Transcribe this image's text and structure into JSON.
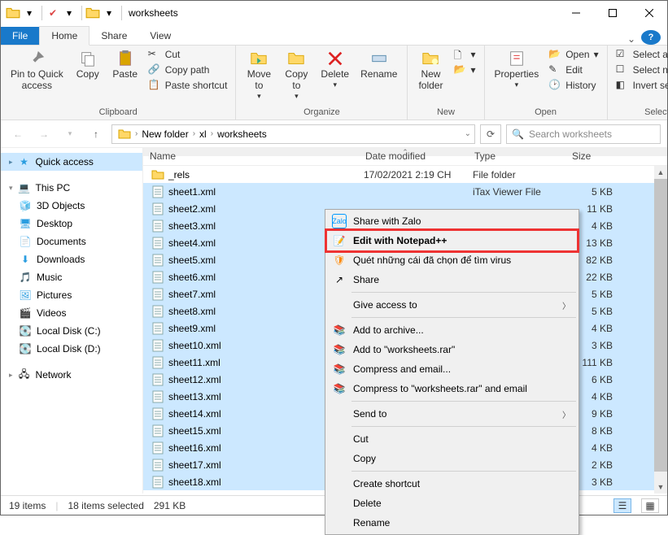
{
  "titlebar": {
    "title": "worksheets"
  },
  "tabs": {
    "file": "File",
    "home": "Home",
    "share": "Share",
    "view": "View"
  },
  "ribbon": {
    "clipboard": {
      "pin": "Pin to Quick\naccess",
      "copy": "Copy",
      "paste": "Paste",
      "cut": "Cut",
      "copypath": "Copy path",
      "pasteshort": "Paste shortcut",
      "label": "Clipboard"
    },
    "organize": {
      "moveto": "Move\nto",
      "copyto": "Copy\nto",
      "delete": "Delete",
      "rename": "Rename",
      "label": "Organize"
    },
    "new": {
      "newfolder": "New\nfolder",
      "label": "New"
    },
    "open": {
      "properties": "Properties",
      "open": "Open",
      "edit": "Edit",
      "history": "History",
      "label": "Open"
    },
    "select": {
      "selectall": "Select all",
      "selectnone": "Select none",
      "invert": "Invert selection",
      "label": "Select"
    }
  },
  "breadcrumb": {
    "b1": "New folder",
    "b2": "xl",
    "b3": "worksheets"
  },
  "search": {
    "placeholder": "Search worksheets"
  },
  "sidebar": {
    "quick": "Quick access",
    "thispc": "This PC",
    "obj3d": "3D Objects",
    "desktop": "Desktop",
    "documents": "Documents",
    "downloads": "Downloads",
    "music": "Music",
    "pictures": "Pictures",
    "videos": "Videos",
    "localc": "Local Disk (C:)",
    "locald": "Local Disk (D:)",
    "network": "Network"
  },
  "columns": {
    "name": "Name",
    "mod": "Date modified",
    "type": "Type",
    "size": "Size"
  },
  "files": [
    {
      "name": "_rels",
      "mod": "17/02/2021 2:19 CH",
      "type": "File folder",
      "size": "",
      "folder": true,
      "sel": false
    },
    {
      "name": "sheet1.xml",
      "mod": "",
      "type": "iTax Viewer File",
      "size": "5 KB",
      "sel": true
    },
    {
      "name": "sheet2.xml",
      "mod": "",
      "type": "",
      "size": "11 KB",
      "sel": true
    },
    {
      "name": "sheet3.xml",
      "mod": "",
      "type": "",
      "size": "4 KB",
      "sel": true
    },
    {
      "name": "sheet4.xml",
      "mod": "",
      "type": "",
      "size": "13 KB",
      "sel": true
    },
    {
      "name": "sheet5.xml",
      "mod": "",
      "type": "",
      "size": "82 KB",
      "sel": true
    },
    {
      "name": "sheet6.xml",
      "mod": "",
      "type": "",
      "size": "22 KB",
      "sel": true
    },
    {
      "name": "sheet7.xml",
      "mod": "",
      "type": "",
      "size": "5 KB",
      "sel": true
    },
    {
      "name": "sheet8.xml",
      "mod": "",
      "type": "",
      "size": "5 KB",
      "sel": true
    },
    {
      "name": "sheet9.xml",
      "mod": "",
      "type": "",
      "size": "4 KB",
      "sel": true
    },
    {
      "name": "sheet10.xml",
      "mod": "",
      "type": "",
      "size": "3 KB",
      "sel": true
    },
    {
      "name": "sheet11.xml",
      "mod": "",
      "type": "",
      "size": "111 KB",
      "sel": true
    },
    {
      "name": "sheet12.xml",
      "mod": "",
      "type": "",
      "size": "6 KB",
      "sel": true
    },
    {
      "name": "sheet13.xml",
      "mod": "",
      "type": "",
      "size": "4 KB",
      "sel": true
    },
    {
      "name": "sheet14.xml",
      "mod": "",
      "type": "",
      "size": "9 KB",
      "sel": true
    },
    {
      "name": "sheet15.xml",
      "mod": "",
      "type": "",
      "size": "8 KB",
      "sel": true
    },
    {
      "name": "sheet16.xml",
      "mod": "",
      "type": "",
      "size": "4 KB",
      "sel": true
    },
    {
      "name": "sheet17.xml",
      "mod": "",
      "type": "",
      "size": "2 KB",
      "sel": true
    },
    {
      "name": "sheet18.xml",
      "mod": "",
      "type": "",
      "size": "3 KB",
      "sel": true
    }
  ],
  "context": {
    "zalo": "Share with Zalo",
    "npp": "Edit with Notepad++",
    "virus": "Quét những cái đã chọn để tìm virus",
    "share": "Share",
    "giveaccess": "Give access to",
    "addarchive": "Add to archive...",
    "addworksheets": "Add to \"worksheets.rar\"",
    "compressemail": "Compress and email...",
    "compressworksheets": "Compress to \"worksheets.rar\" and email",
    "sendto": "Send to",
    "cut": "Cut",
    "copy": "Copy",
    "createshort": "Create shortcut",
    "delete": "Delete",
    "rename": "Rename"
  },
  "status": {
    "items": "19 items",
    "selected": "18 items selected",
    "size": "291 KB"
  }
}
